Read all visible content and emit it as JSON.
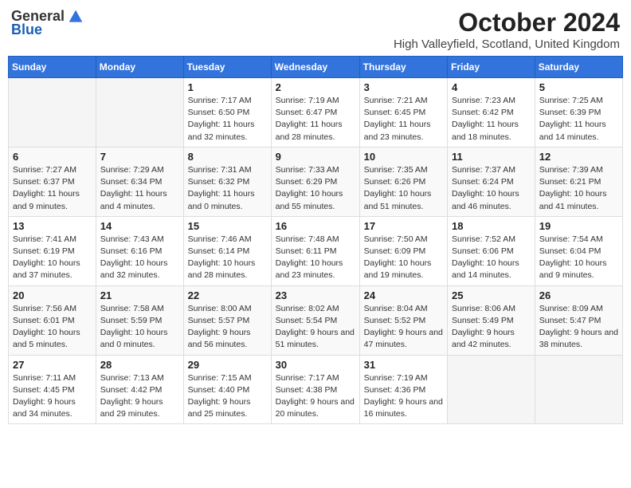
{
  "logo": {
    "general": "General",
    "blue": "Blue"
  },
  "title": "October 2024",
  "location": "High Valleyfield, Scotland, United Kingdom",
  "days_header": [
    "Sunday",
    "Monday",
    "Tuesday",
    "Wednesday",
    "Thursday",
    "Friday",
    "Saturday"
  ],
  "weeks": [
    [
      {
        "num": "",
        "detail": ""
      },
      {
        "num": "",
        "detail": ""
      },
      {
        "num": "1",
        "detail": "Sunrise: 7:17 AM\nSunset: 6:50 PM\nDaylight: 11 hours\nand 32 minutes."
      },
      {
        "num": "2",
        "detail": "Sunrise: 7:19 AM\nSunset: 6:47 PM\nDaylight: 11 hours\nand 28 minutes."
      },
      {
        "num": "3",
        "detail": "Sunrise: 7:21 AM\nSunset: 6:45 PM\nDaylight: 11 hours\nand 23 minutes."
      },
      {
        "num": "4",
        "detail": "Sunrise: 7:23 AM\nSunset: 6:42 PM\nDaylight: 11 hours\nand 18 minutes."
      },
      {
        "num": "5",
        "detail": "Sunrise: 7:25 AM\nSunset: 6:39 PM\nDaylight: 11 hours\nand 14 minutes."
      }
    ],
    [
      {
        "num": "6",
        "detail": "Sunrise: 7:27 AM\nSunset: 6:37 PM\nDaylight: 11 hours\nand 9 minutes."
      },
      {
        "num": "7",
        "detail": "Sunrise: 7:29 AM\nSunset: 6:34 PM\nDaylight: 11 hours\nand 4 minutes."
      },
      {
        "num": "8",
        "detail": "Sunrise: 7:31 AM\nSunset: 6:32 PM\nDaylight: 11 hours\nand 0 minutes."
      },
      {
        "num": "9",
        "detail": "Sunrise: 7:33 AM\nSunset: 6:29 PM\nDaylight: 10 hours\nand 55 minutes."
      },
      {
        "num": "10",
        "detail": "Sunrise: 7:35 AM\nSunset: 6:26 PM\nDaylight: 10 hours\nand 51 minutes."
      },
      {
        "num": "11",
        "detail": "Sunrise: 7:37 AM\nSunset: 6:24 PM\nDaylight: 10 hours\nand 46 minutes."
      },
      {
        "num": "12",
        "detail": "Sunrise: 7:39 AM\nSunset: 6:21 PM\nDaylight: 10 hours\nand 41 minutes."
      }
    ],
    [
      {
        "num": "13",
        "detail": "Sunrise: 7:41 AM\nSunset: 6:19 PM\nDaylight: 10 hours\nand 37 minutes."
      },
      {
        "num": "14",
        "detail": "Sunrise: 7:43 AM\nSunset: 6:16 PM\nDaylight: 10 hours\nand 32 minutes."
      },
      {
        "num": "15",
        "detail": "Sunrise: 7:46 AM\nSunset: 6:14 PM\nDaylight: 10 hours\nand 28 minutes."
      },
      {
        "num": "16",
        "detail": "Sunrise: 7:48 AM\nSunset: 6:11 PM\nDaylight: 10 hours\nand 23 minutes."
      },
      {
        "num": "17",
        "detail": "Sunrise: 7:50 AM\nSunset: 6:09 PM\nDaylight: 10 hours\nand 19 minutes."
      },
      {
        "num": "18",
        "detail": "Sunrise: 7:52 AM\nSunset: 6:06 PM\nDaylight: 10 hours\nand 14 minutes."
      },
      {
        "num": "19",
        "detail": "Sunrise: 7:54 AM\nSunset: 6:04 PM\nDaylight: 10 hours\nand 9 minutes."
      }
    ],
    [
      {
        "num": "20",
        "detail": "Sunrise: 7:56 AM\nSunset: 6:01 PM\nDaylight: 10 hours\nand 5 minutes."
      },
      {
        "num": "21",
        "detail": "Sunrise: 7:58 AM\nSunset: 5:59 PM\nDaylight: 10 hours\nand 0 minutes."
      },
      {
        "num": "22",
        "detail": "Sunrise: 8:00 AM\nSunset: 5:57 PM\nDaylight: 9 hours\nand 56 minutes."
      },
      {
        "num": "23",
        "detail": "Sunrise: 8:02 AM\nSunset: 5:54 PM\nDaylight: 9 hours\nand 51 minutes."
      },
      {
        "num": "24",
        "detail": "Sunrise: 8:04 AM\nSunset: 5:52 PM\nDaylight: 9 hours\nand 47 minutes."
      },
      {
        "num": "25",
        "detail": "Sunrise: 8:06 AM\nSunset: 5:49 PM\nDaylight: 9 hours\nand 42 minutes."
      },
      {
        "num": "26",
        "detail": "Sunrise: 8:09 AM\nSunset: 5:47 PM\nDaylight: 9 hours\nand 38 minutes."
      }
    ],
    [
      {
        "num": "27",
        "detail": "Sunrise: 7:11 AM\nSunset: 4:45 PM\nDaylight: 9 hours\nand 34 minutes."
      },
      {
        "num": "28",
        "detail": "Sunrise: 7:13 AM\nSunset: 4:42 PM\nDaylight: 9 hours\nand 29 minutes."
      },
      {
        "num": "29",
        "detail": "Sunrise: 7:15 AM\nSunset: 4:40 PM\nDaylight: 9 hours\nand 25 minutes."
      },
      {
        "num": "30",
        "detail": "Sunrise: 7:17 AM\nSunset: 4:38 PM\nDaylight: 9 hours\nand 20 minutes."
      },
      {
        "num": "31",
        "detail": "Sunrise: 7:19 AM\nSunset: 4:36 PM\nDaylight: 9 hours\nand 16 minutes."
      },
      {
        "num": "",
        "detail": ""
      },
      {
        "num": "",
        "detail": ""
      }
    ]
  ]
}
